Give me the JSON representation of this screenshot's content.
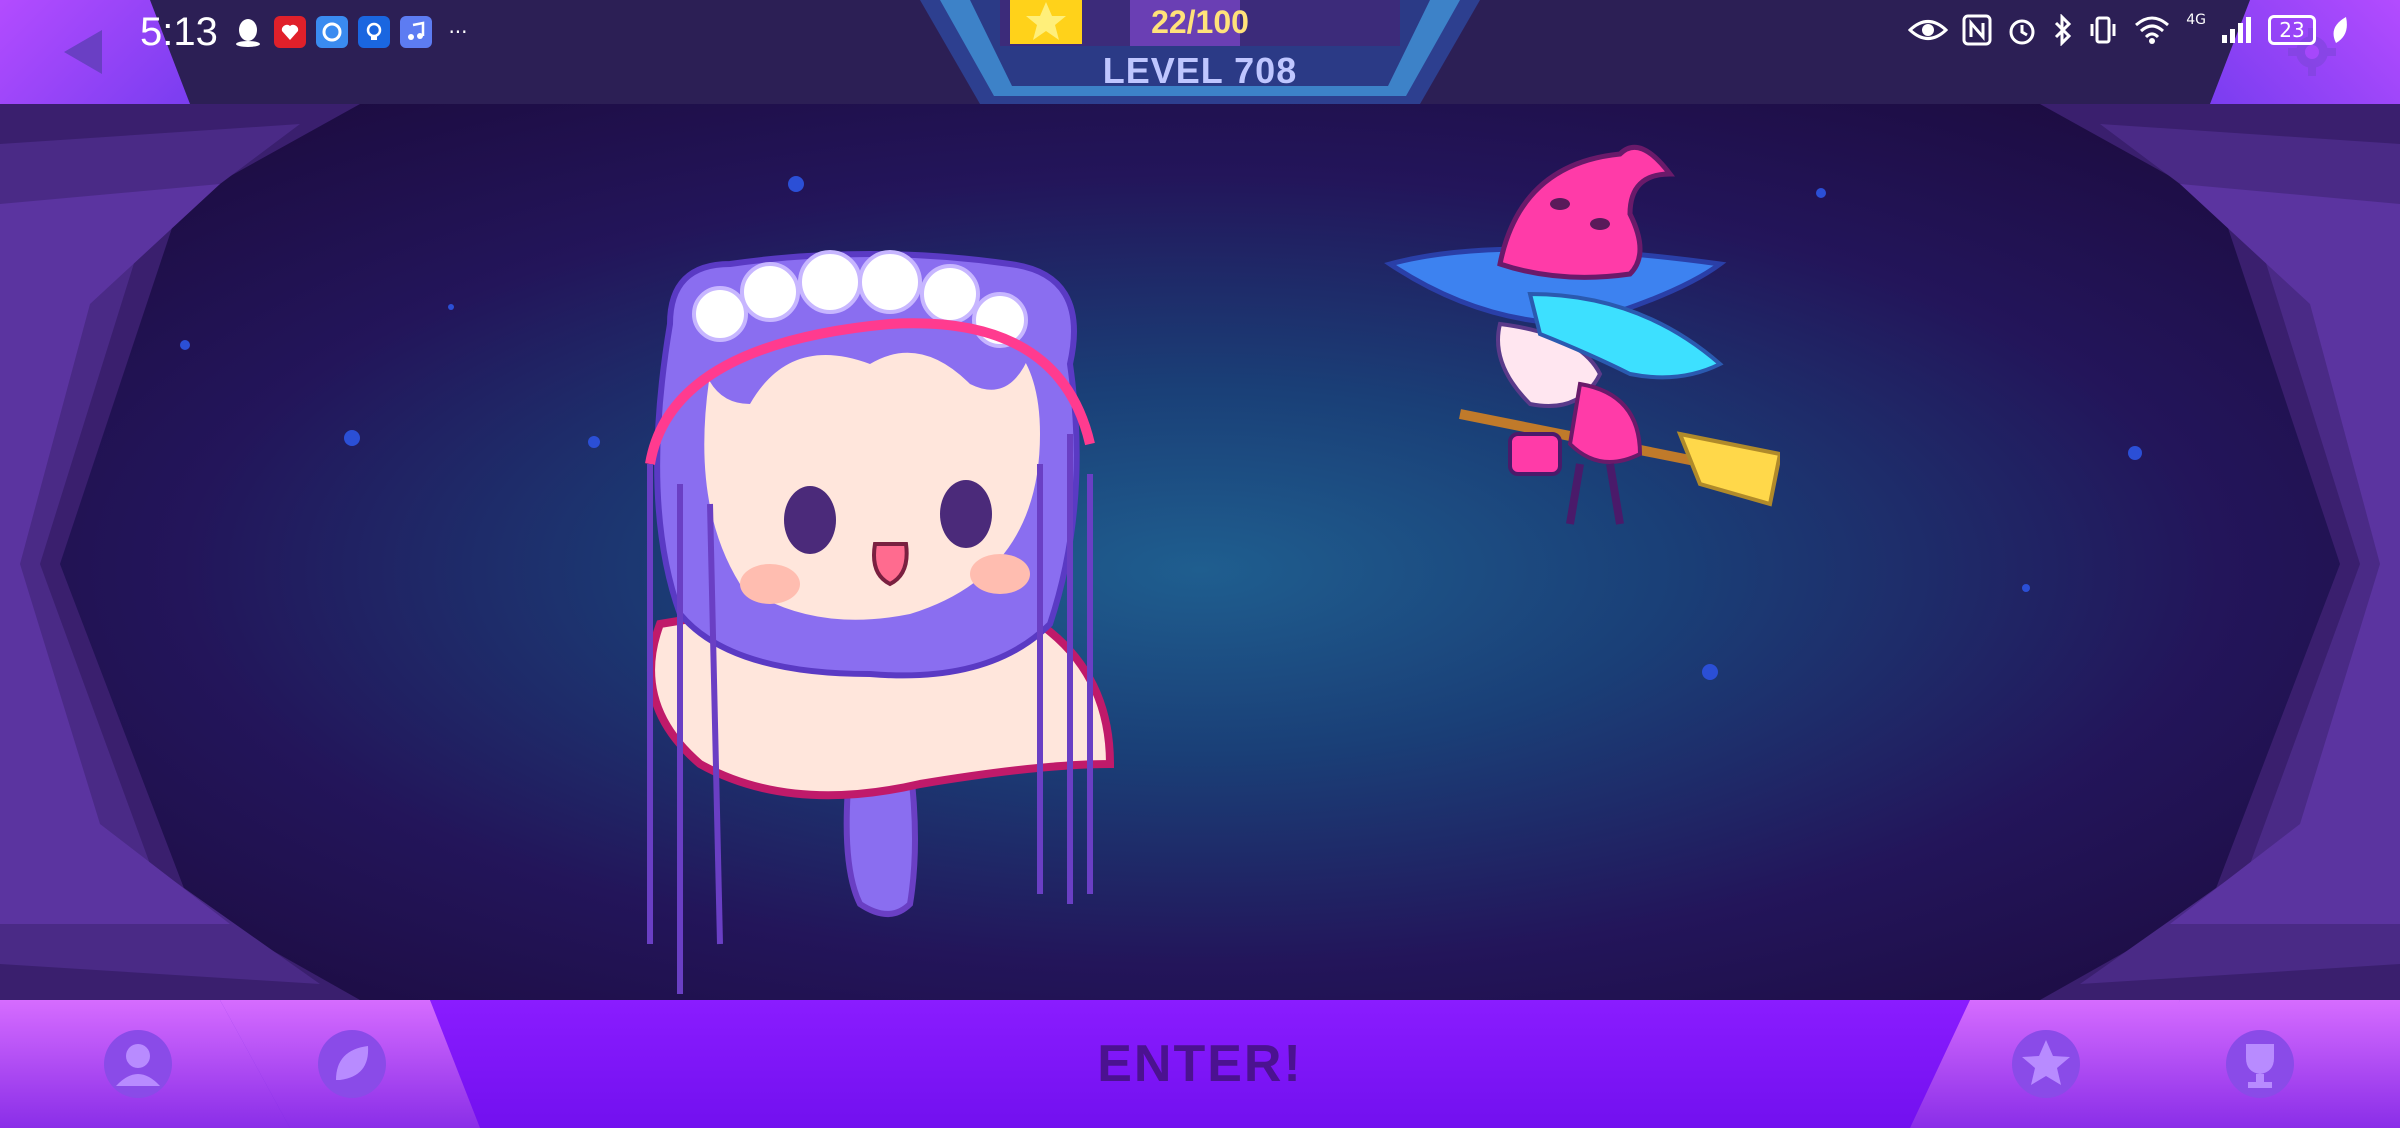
{
  "status_bar": {
    "time": "5:13",
    "left_icons": [
      "qq-icon",
      "app-red-icon",
      "app-blue-icon",
      "bulb-app-icon",
      "music-app-icon",
      "more-icon"
    ],
    "more_label": "···",
    "battery": "23",
    "network": "4G"
  },
  "header": {
    "progress": "22/100",
    "level": "LEVEL  708"
  },
  "bottom": {
    "enter_label": "ENTER!"
  },
  "colors": {
    "accent_purple": "#8a1cff",
    "progress_gold": "#ffe27a",
    "level_text": "#bfc6ff"
  }
}
